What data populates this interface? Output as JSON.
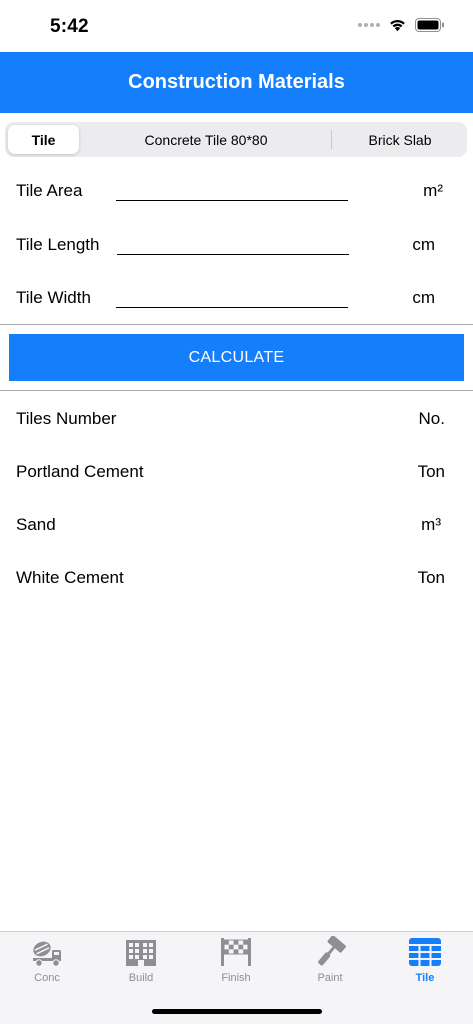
{
  "status_bar": {
    "time": "5:42"
  },
  "nav": {
    "title": "Construction Materials"
  },
  "segments": {
    "tile": "Tile",
    "concrete": "Concrete Tile 80*80",
    "brick": "Brick Slab",
    "selected": "Tile"
  },
  "inputs": {
    "area": {
      "label": "Tile Area",
      "value": "",
      "unit": "m²"
    },
    "length": {
      "label": "Tile Length",
      "value": "",
      "unit": "cm"
    },
    "width": {
      "label": "Tile Width",
      "value": "",
      "unit": "cm"
    }
  },
  "calculate_label": "CALCULATE",
  "results": {
    "tiles": {
      "label": "Tiles Number",
      "unit": "No."
    },
    "portland": {
      "label": "Portland Cement",
      "unit": "Ton"
    },
    "sand": {
      "label": "Sand",
      "unit": "m³"
    },
    "white": {
      "label": "White Cement",
      "unit": "Ton"
    }
  },
  "tabs": {
    "conc": {
      "label": "Conc",
      "icon": "concrete-mixer-icon"
    },
    "build": {
      "label": "Build",
      "icon": "building-icon"
    },
    "finish": {
      "label": "Finish",
      "icon": "checkered-flag-icon"
    },
    "paint": {
      "label": "Paint",
      "icon": "paint-roller-icon"
    },
    "tile": {
      "label": "Tile",
      "icon": "tile-icon",
      "active": true
    }
  },
  "colors": {
    "accent": "#157efb",
    "inactive_tab": "#8e8e93",
    "tab_bar_bg": "#f5f5f7",
    "segment_bg": "#ececef"
  }
}
